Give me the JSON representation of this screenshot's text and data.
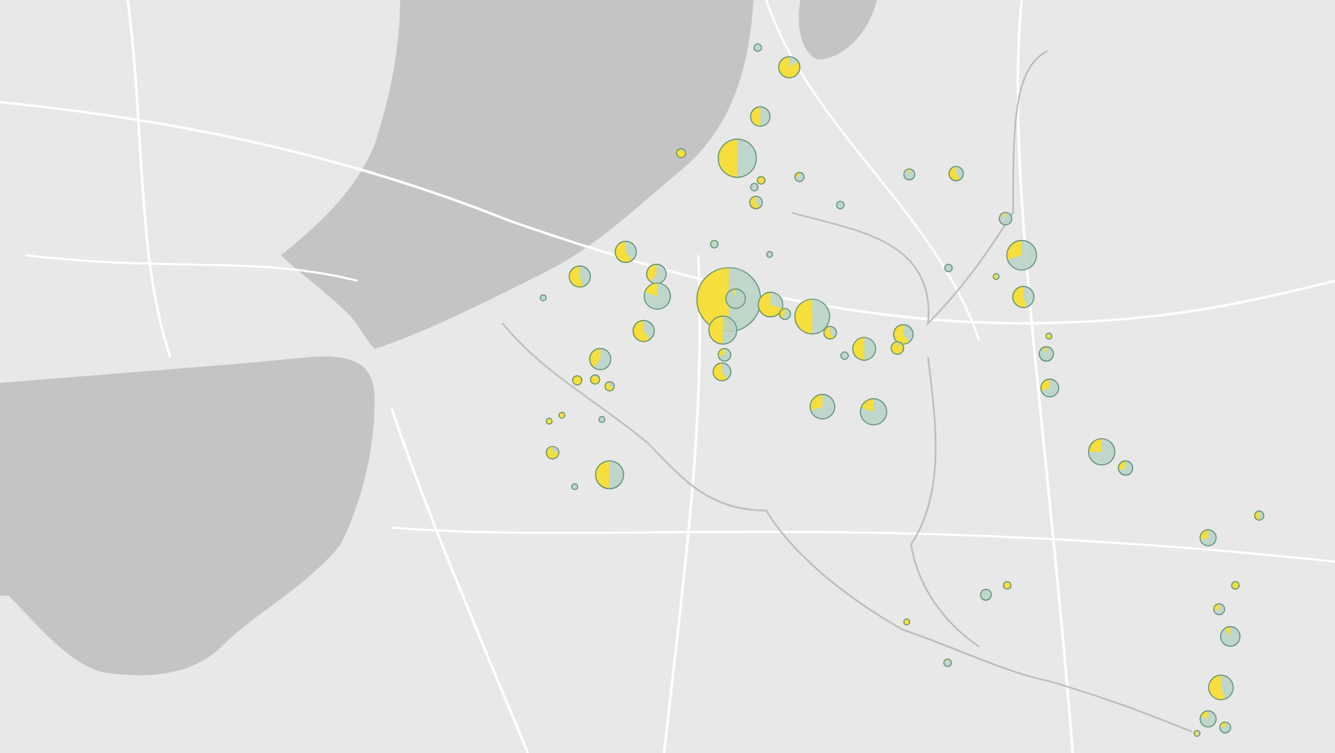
{
  "markers": [
    {
      "kind": "pie"
    },
    {
      "kind": "pie"
    },
    {
      "kind": "pie"
    },
    {
      "kind": "pie"
    },
    {
      "kind": "pie"
    },
    {
      "kind": "pie"
    },
    {
      "kind": "pie"
    },
    {
      "kind": "pie"
    },
    {
      "kind": "pie"
    },
    {
      "kind": "pie"
    },
    {
      "kind": "pie"
    },
    {
      "kind": "pie"
    },
    {
      "kind": "pie"
    },
    {
      "kind": "pie"
    },
    {
      "kind": "pie"
    },
    {
      "kind": "pie"
    },
    {
      "kind": "pie"
    },
    {
      "kind": "pie"
    },
    {
      "kind": "pie"
    },
    {
      "kind": "pie"
    },
    {
      "kind": "pie"
    },
    {
      "kind": "pie"
    },
    {
      "kind": "pie"
    },
    {
      "kind": "pie"
    },
    {
      "kind": "pie"
    },
    {
      "kind": "pie"
    },
    {
      "kind": "pie"
    },
    {
      "kind": "pie"
    },
    {
      "kind": "pie"
    },
    {
      "kind": "pie"
    },
    {
      "kind": "pie"
    },
    {
      "kind": "pie"
    },
    {
      "kind": "pie"
    },
    {
      "kind": "pie"
    },
    {
      "kind": "pie"
    },
    {
      "kind": "pie"
    },
    {
      "kind": "pie"
    },
    {
      "kind": "pie"
    },
    {
      "kind": "pie"
    },
    {
      "kind": "pie"
    },
    {
      "kind": "pie"
    },
    {
      "kind": "pie"
    },
    {
      "kind": "pie"
    },
    {
      "kind": "pie"
    },
    {
      "kind": "pie"
    },
    {
      "kind": "pie"
    },
    {
      "kind": "pie"
    },
    {
      "kind": "pie"
    },
    {
      "kind": "pie"
    },
    {
      "kind": "pie"
    },
    {
      "kind": "pie"
    },
    {
      "kind": "pie"
    },
    {
      "kind": "pie"
    },
    {
      "kind": "pie"
    },
    {
      "kind": "pie"
    },
    {
      "kind": "pie"
    },
    {
      "kind": "pie"
    },
    {
      "kind": "pie"
    },
    {
      "kind": "pie"
    },
    {
      "kind": "pie"
    },
    {
      "kind": "pie"
    },
    {
      "kind": "pie"
    },
    {
      "kind": "pie"
    },
    {
      "kind": "pie"
    },
    {
      "kind": "pie"
    },
    {
      "kind": "pie"
    },
    {
      "kind": "pie"
    },
    {
      "kind": "pie"
    }
  ]
}
